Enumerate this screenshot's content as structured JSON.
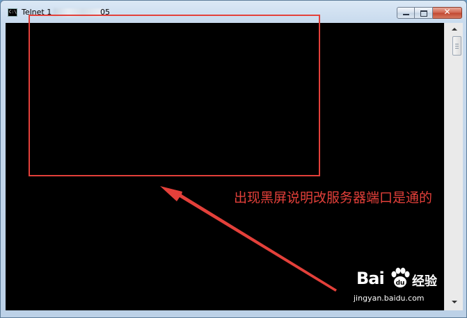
{
  "window": {
    "title_prefix": "Telnet 1",
    "title_suffix": "05",
    "icon": "console-icon",
    "controls": {
      "minimize_icon": "minimize-icon",
      "maximize_icon": "maximize-icon",
      "close_icon": "close-icon",
      "close_glyph": "✕"
    },
    "console_background": "#000000"
  },
  "annotation": {
    "text": "出现黑屏说明改服务器端口是通的",
    "color": "#e3403a"
  },
  "watermark": {
    "brand": "Bai",
    "brand_suffix": "经验",
    "url": "jingyan.baidu.com",
    "icon": "paw-icon"
  }
}
